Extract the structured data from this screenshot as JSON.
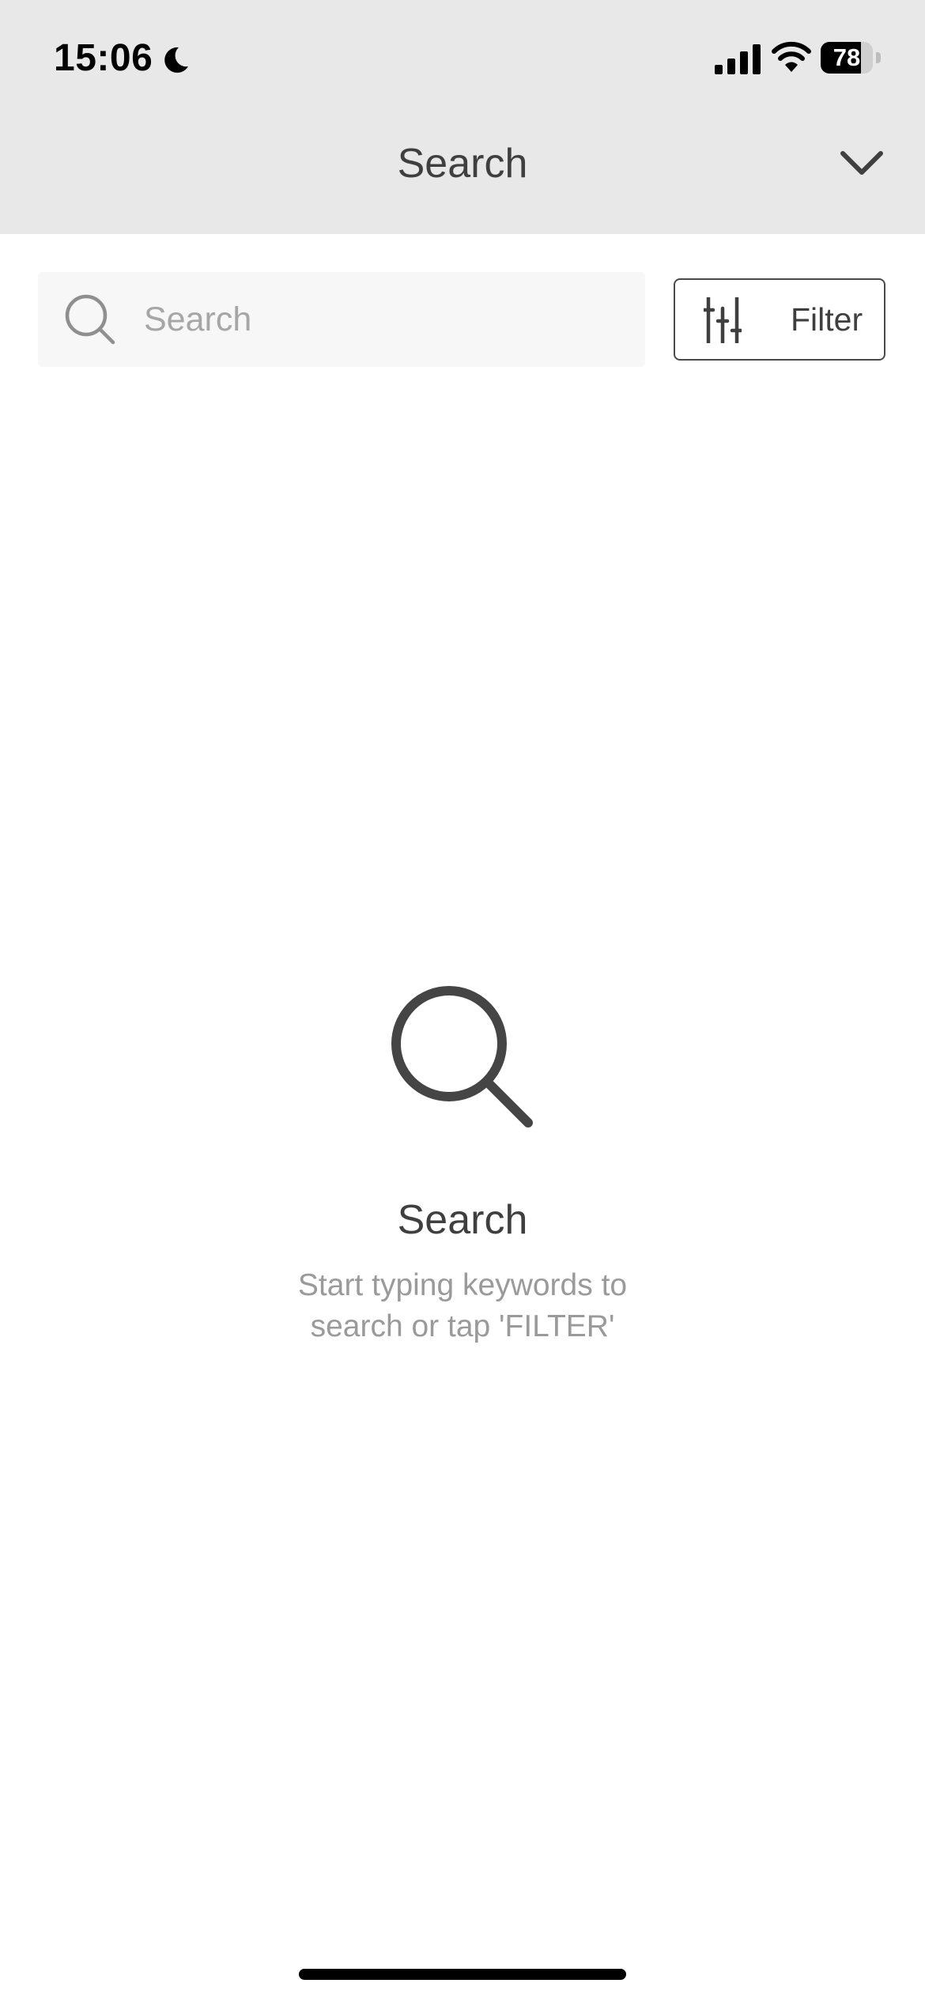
{
  "status_bar": {
    "time": "15:06",
    "battery_percent": 78,
    "battery_label": "78",
    "icons": [
      "moon-icon",
      "signal-icon",
      "wifi-icon",
      "battery-icon"
    ]
  },
  "header": {
    "title": "Search",
    "collapse_icon": "chevron-down-icon"
  },
  "search": {
    "placeholder": "Search",
    "value": "",
    "icon": "search-icon"
  },
  "filter": {
    "label": "Filter",
    "icon": "sliders-icon"
  },
  "empty_state": {
    "icon": "search-icon",
    "title": "Search",
    "message": "Start typing keywords to search or tap 'FILTER'"
  },
  "colors": {
    "header_background": "#e8e8e8",
    "text_primary": "#3f3f3f",
    "text_secondary": "#9a9a9a",
    "search_background": "#f7f7f7"
  }
}
